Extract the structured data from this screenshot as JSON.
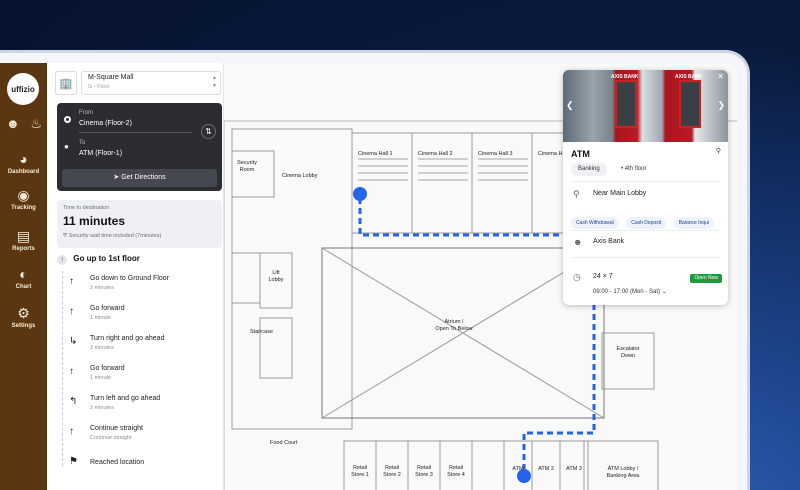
{
  "app": {
    "logo_text": "uffizio",
    "nav": [
      {
        "label": "Dashboard",
        "icon": "dashboard-icon"
      },
      {
        "label": "Tracking",
        "icon": "tracking-icon"
      },
      {
        "label": "Reports",
        "icon": "reports-icon"
      },
      {
        "label": "Chart",
        "icon": "chart-icon"
      },
      {
        "label": "Settings",
        "icon": "settings-icon"
      }
    ]
  },
  "panel": {
    "mall_name": "M-Square Mall",
    "floor": "G - Floor",
    "from_label": "From",
    "from_value": "Cinema (Floor-2)",
    "to_label": "To",
    "to_value": "ATM (Floor-1)",
    "get_directions": "Get Directions",
    "time_label": "Time to destination",
    "time_value": "11 minutes",
    "time_note": "Security wait time included (7minutes)",
    "go_up": "Go up to 1st floor",
    "steps": [
      {
        "main": "Go down to Ground Floor",
        "sub": "2 minutes",
        "icon": "arrow-up-icon"
      },
      {
        "main": "Go forward",
        "sub": "1 minute",
        "icon": "arrow-up-icon"
      },
      {
        "main": "Turn right and go ahead",
        "sub": "2 minutes",
        "icon": "turn-right-icon"
      },
      {
        "main": "Go forward",
        "sub": "1 minute",
        "icon": "arrow-up-icon"
      },
      {
        "main": "Turn left and go ahead",
        "sub": "2 minutes",
        "icon": "turn-left-icon"
      },
      {
        "main": "Continue straight",
        "sub": "Continue straight",
        "icon": "arrow-up-icon"
      },
      {
        "main": "Reached location",
        "sub": "",
        "icon": "flag-icon"
      }
    ]
  },
  "map": {
    "labels": {
      "security_room": "Security\nRoom",
      "cinema_lobby": "Cinema Lobby",
      "cinema_hall_1": "Cinema Hall 1",
      "cinema_hall_2": "Cinema Hall 2",
      "cinema_hall_3": "Cinema Hall 3",
      "cinema_hall_4": "Cinema H",
      "lift_lobby": "Lift\nLobby",
      "staircase": "Staircase",
      "atrium": "Atrium /\nOpen To Below",
      "escalator": "Escalator\nDown",
      "food_court": "Food Court",
      "retail_1": "Retail\nStore 1",
      "retail_2": "Retail\nStore 2",
      "retail_3": "Retail\nStore 3",
      "retail_4": "Retail\nStore 4",
      "atm_1": "ATM",
      "atm_2": "ATM 2",
      "atm_3": "ATM 3",
      "atm_lobby": "ATM Lobby /\nBanking Area"
    }
  },
  "card": {
    "title": "ATM",
    "photo_banner": "AXIS BANK",
    "category": "Banking",
    "floor": "4th floor",
    "location": "Near Main Lobby",
    "services": [
      "Cash Withdrawal",
      "Cash Deposit",
      "Balance Inqui"
    ],
    "bank": "Axis Bank",
    "availability": "24 × 7",
    "status": "Open Now",
    "hours": "09:00 - 17:00 (Mon - Sat)"
  },
  "colors": {
    "rail": "#5a3711",
    "route": "#2563eb",
    "open": "#1d9b3f"
  }
}
